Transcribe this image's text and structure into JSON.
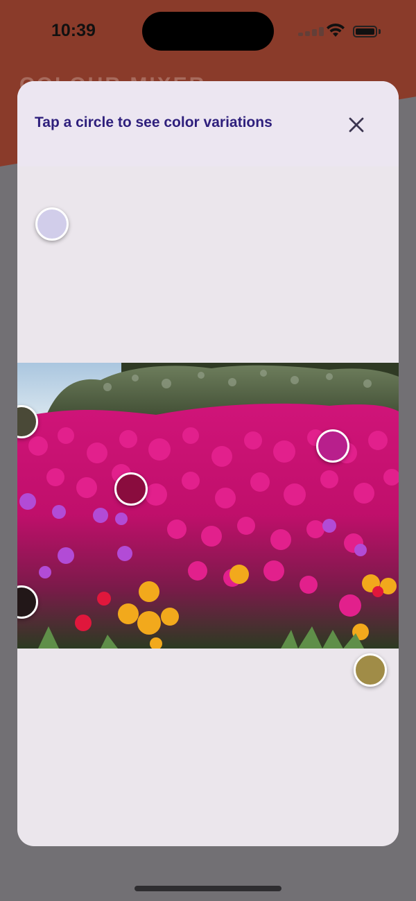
{
  "status_bar": {
    "time": "10:39"
  },
  "background_app": {
    "title": "COLOUR MIXER",
    "header_color": "#8a3b2a"
  },
  "modal": {
    "title": "Tap a circle to see color variations",
    "close_icon": "close-icon",
    "title_color": "#2e1f7c"
  },
  "swatches": [
    {
      "name": "lavender",
      "color": "#d1cdea"
    },
    {
      "name": "olive-dark",
      "color": "#4a4937"
    },
    {
      "name": "magenta",
      "color": "#b81f8c"
    },
    {
      "name": "crimson",
      "color": "#8a0c3e"
    },
    {
      "name": "near-black",
      "color": "#221718"
    },
    {
      "name": "ochre",
      "color": "#a08c47"
    }
  ],
  "photo": {
    "description_icon": "flower-field-photo"
  }
}
